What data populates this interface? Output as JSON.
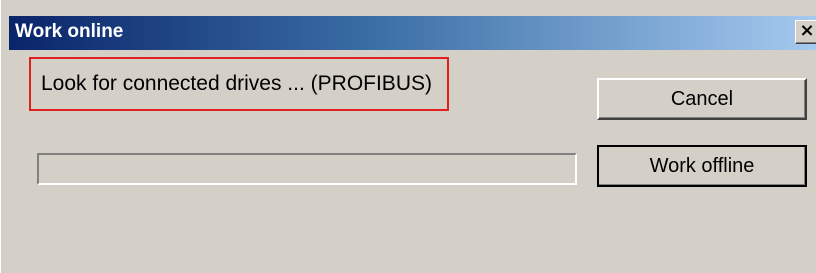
{
  "window": {
    "title": "Work online",
    "close_glyph": "×",
    "colors": {
      "title_gradient_start": "#0a246a",
      "title_gradient_end": "#a6caf0",
      "dialog_background": "#d4d0c8",
      "highlight_border": "#e0201f"
    }
  },
  "status": {
    "message": "Look for connected drives ... (PROFIBUS)"
  },
  "progress": {
    "value_percent": 0
  },
  "buttons": {
    "cancel_label": "Cancel",
    "work_offline_label": "Work offline"
  }
}
